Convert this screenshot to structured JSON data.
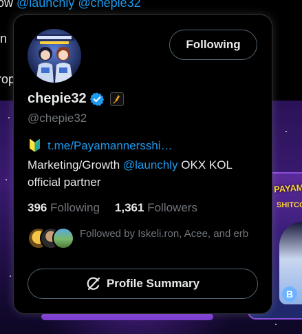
{
  "background": {
    "line1_prefix": "ow ",
    "line1_mentions": "@launchly @chepie32",
    "line2": "in",
    "line3": "rop",
    "right_card_title": "PAYAM",
    "right_card_sub": "SHITCO",
    "coin_symbol": "B"
  },
  "card": {
    "follow_button_label": "Following",
    "display_name": "chepie32",
    "handle": "@chepie32",
    "bio_emoji": "🔰",
    "bio_link": "t.me/Payamannersshi…",
    "bio_text_before": "Marketing/Growth ",
    "bio_mention": "@launchly",
    "bio_text_after": " OKX KOL official partner",
    "following_count": "396",
    "following_label": "Following",
    "followers_count": "1,361",
    "followers_label": "Followers",
    "followed_by_text": "Followed by Iskeli.ron, Acee, and erb",
    "profile_summary_label": "Profile Summary",
    "icons": {
      "verified": "verified-check-icon",
      "affiliate": "affiliate-badge-icon",
      "summary": "grok-slash-circle-icon"
    },
    "colors": {
      "link": "#1d9bf0",
      "muted": "#71767b",
      "text": "#e7e9ea",
      "border": "#536471"
    }
  }
}
